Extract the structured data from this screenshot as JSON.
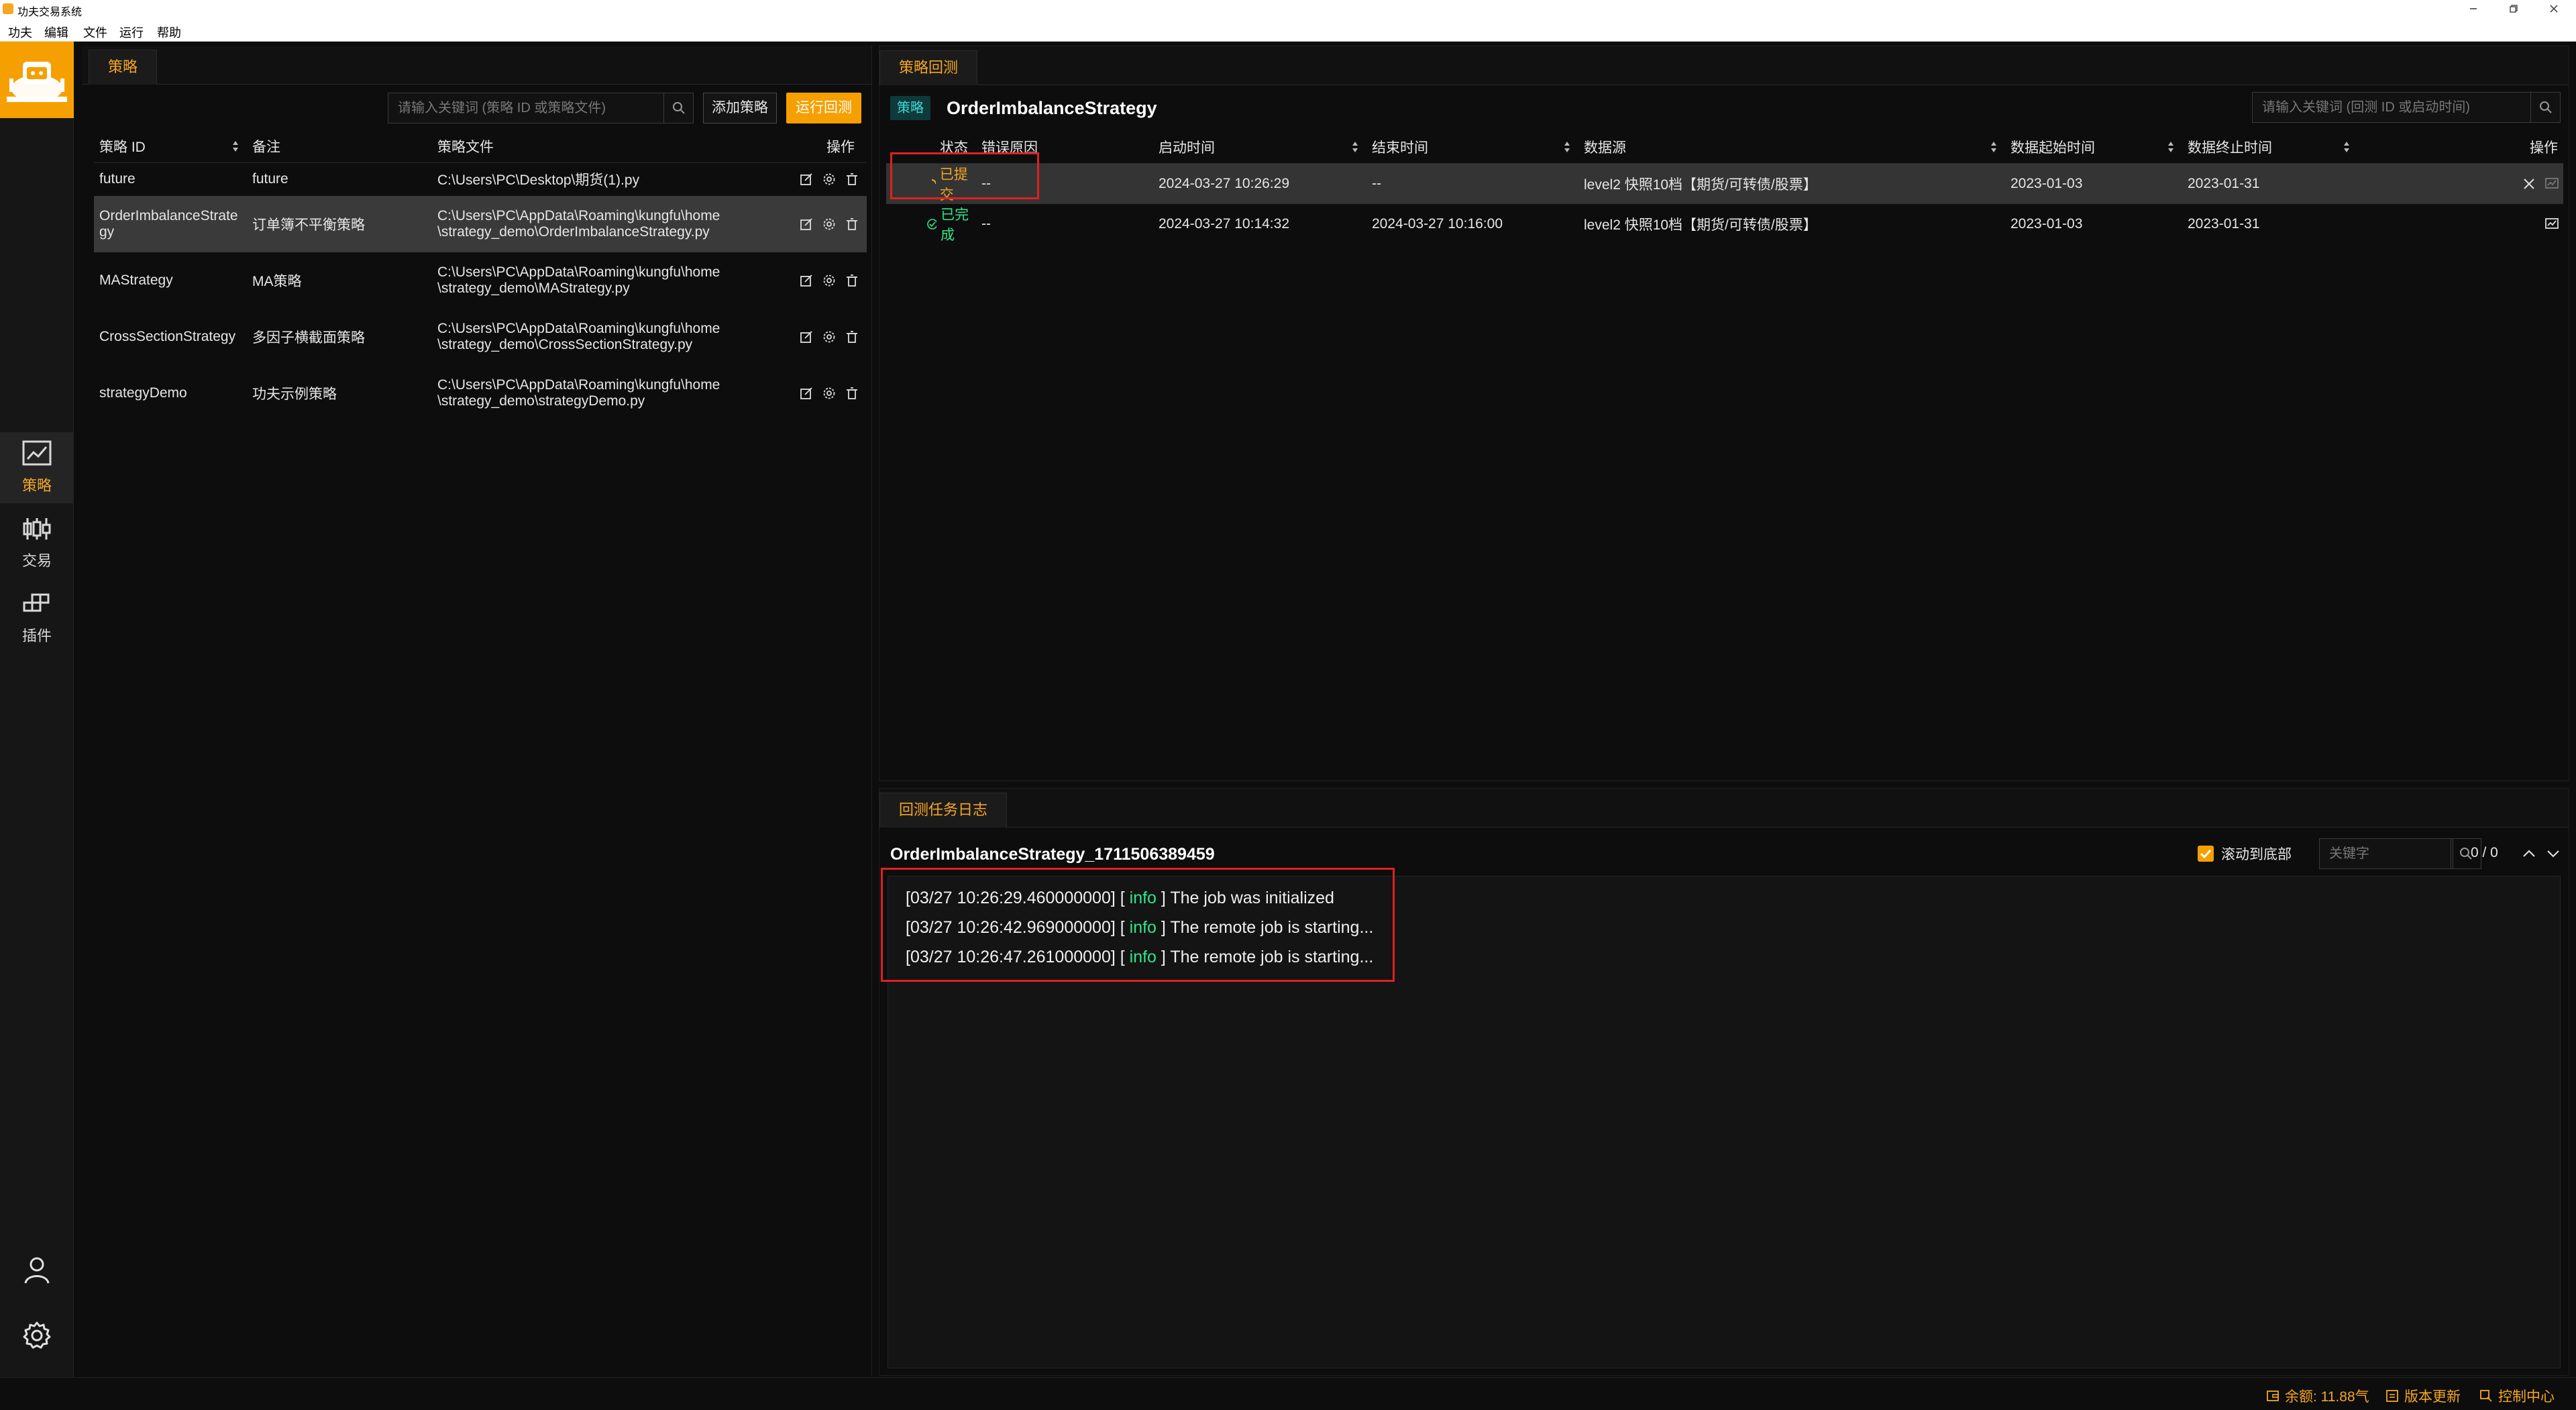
{
  "window": {
    "title": "功夫交易系统"
  },
  "menu": [
    "功夫",
    "编辑",
    "文件",
    "运行",
    "帮助"
  ],
  "nav": {
    "items": [
      {
        "label": "策略",
        "icon": "chart-line-icon",
        "active": true
      },
      {
        "label": "交易",
        "icon": "candlestick-icon",
        "active": false
      },
      {
        "label": "插件",
        "icon": "blocks-icon",
        "active": false
      }
    ],
    "bottom_icons": [
      "user-icon",
      "gear-icon"
    ]
  },
  "strategy_panel": {
    "tab": "策略",
    "search_placeholder": "请输入关键词 (策略 ID 或策略文件)",
    "add_button": "添加策略",
    "run_button": "运行回测",
    "columns": [
      "策略 ID",
      "备注",
      "策略文件",
      "操作"
    ],
    "rows": [
      {
        "id": "future",
        "note": "future",
        "file": "C:\\Users\\PC\\Desktop\\期货(1).py",
        "file2": ""
      },
      {
        "id": "OrderImbalanceStrate",
        "id2": "gy",
        "note": "订单簿不平衡策略",
        "file": "C:\\Users\\PC\\AppData\\Roaming\\kungfu\\home",
        "file2": "\\strategy_demo\\OrderImbalanceStrategy.py"
      },
      {
        "id": "MAStrategy",
        "note": "MA策略",
        "file": "C:\\Users\\PC\\AppData\\Roaming\\kungfu\\home",
        "file2": "\\strategy_demo\\MAStrategy.py"
      },
      {
        "id": "CrossSectionStrategy",
        "note": "多因子横截面策略",
        "file": "C:\\Users\\PC\\AppData\\Roaming\\kungfu\\home",
        "file2": "\\strategy_demo\\CrossSectionStrategy.py"
      },
      {
        "id": "strategyDemo",
        "note": "功夫示例策略",
        "file": "C:\\Users\\PC\\AppData\\Roaming\\kungfu\\home",
        "file2": "\\strategy_demo\\strategyDemo.py"
      }
    ]
  },
  "backtest_panel": {
    "tab": "策略回测",
    "badge": "策略",
    "strategy_name": "OrderImbalanceStrategy",
    "search_placeholder": "请输入关键词 (回测 ID 或启动时间)",
    "columns": [
      "状态",
      "错误原因",
      "启动时间",
      "结束时间",
      "数据源",
      "数据起始时间",
      "数据终止时间",
      "操作"
    ],
    "rows": [
      {
        "status": "已提交",
        "status_color": "#f5a623",
        "error": "--",
        "start": "2024-03-27 10:26:29",
        "end": "--",
        "source": "level2 快照10档【期货/可转债/股票】",
        "data_start": "2023-01-03",
        "data_end": "2023-01-31"
      },
      {
        "status": "已完成",
        "status_color": "#2ee88b",
        "error": "--",
        "start": "2024-03-27 10:14:32",
        "end": "2024-03-27 10:16:00",
        "source": "level2 快照10档【期货/可转债/股票】",
        "data_start": "2023-01-03",
        "data_end": "2023-01-31"
      }
    ]
  },
  "log_panel": {
    "tab": "回测任务日志",
    "title": "OrderImbalanceStrategy_1711506389459",
    "scroll_label": "滚动到底部",
    "scroll_checked": true,
    "keyword_placeholder": "关键字",
    "counter": "0 / 0",
    "lines": [
      {
        "time": "[03/27 10:26:29.460000000]",
        "open": "[",
        "level": "info",
        "close": "]",
        "msg": "The job was initialized"
      },
      {
        "time": "[03/27 10:26:42.969000000]",
        "open": "[",
        "level": "info",
        "close": "]",
        "msg": "The remote job is starting..."
      },
      {
        "time": "[03/27 10:26:47.261000000]",
        "open": "[",
        "level": "info",
        "close": "]",
        "msg": "The remote job is starting..."
      }
    ]
  },
  "statusbar": {
    "balance": "余额: 11.88气",
    "update": "版本更新",
    "control": "控制中心"
  },
  "colors": {
    "accent": "#f5a000",
    "success": "#2ee88b",
    "highlight_box": "#e02020"
  }
}
